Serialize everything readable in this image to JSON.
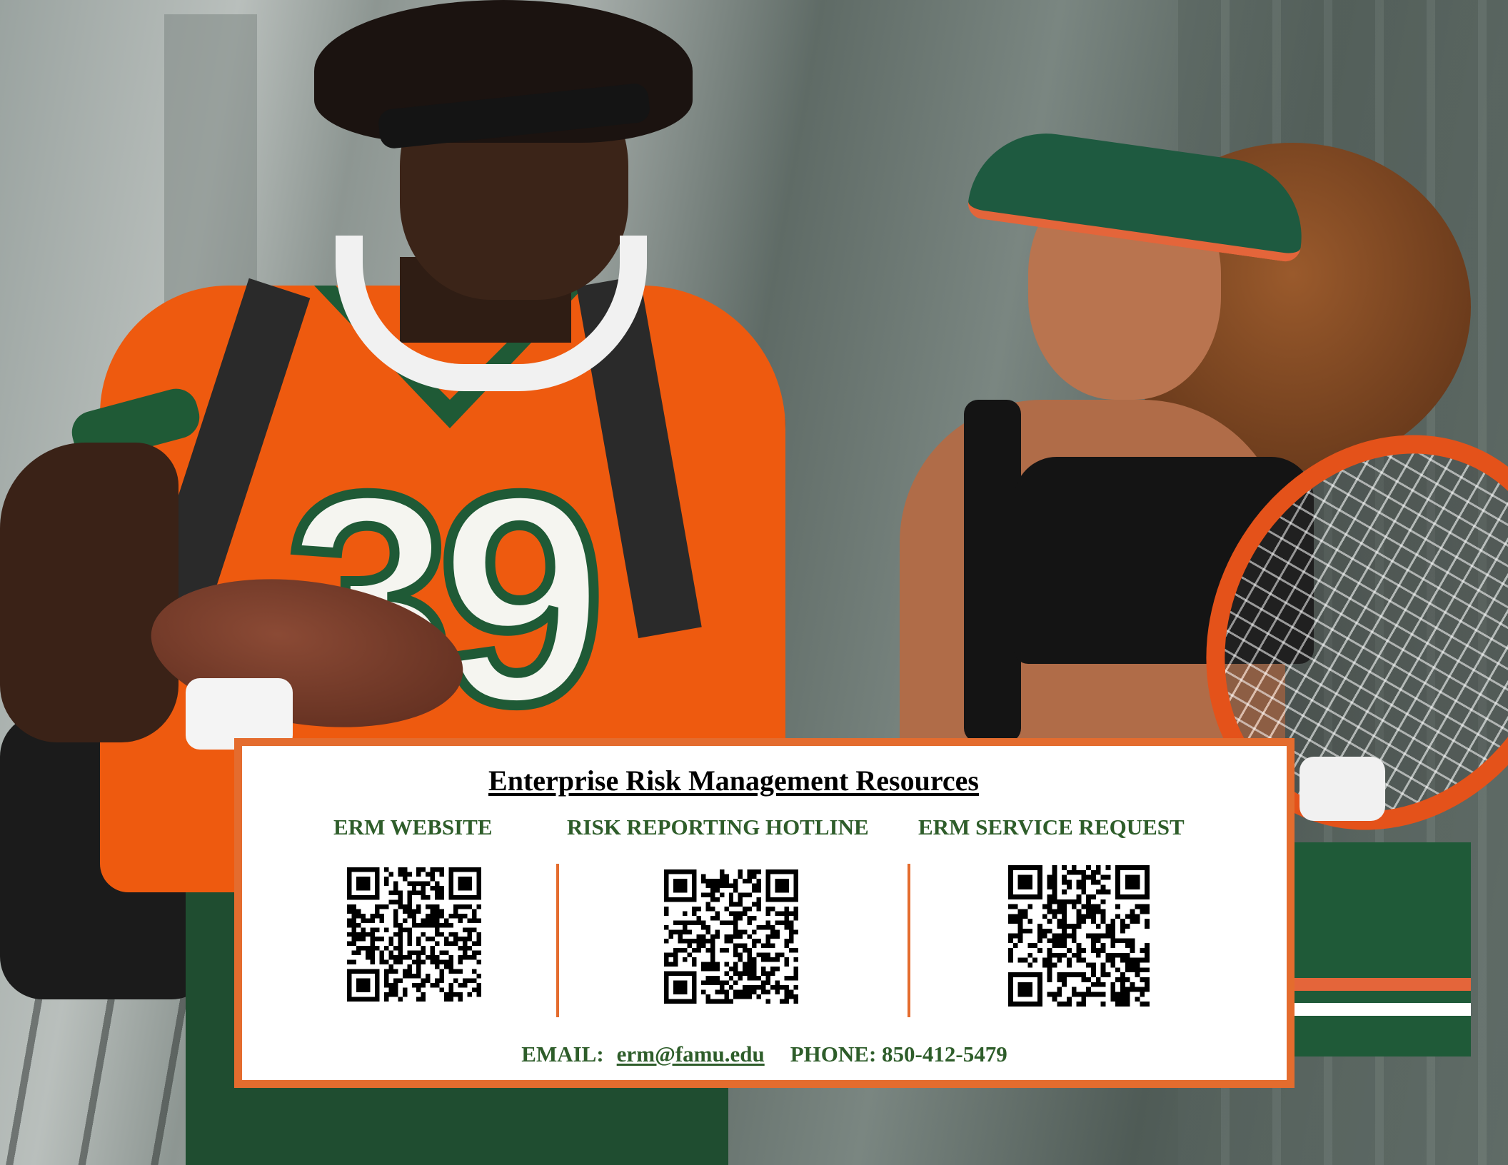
{
  "photo": {
    "jersey_number": "39"
  },
  "card": {
    "title": "Enterprise Risk Management Resources",
    "columns": [
      {
        "heading": "ERM WEBSITE"
      },
      {
        "heading": "RISK REPORTING HOTLINE"
      },
      {
        "heading": "ERM SERVICE REQUEST"
      }
    ],
    "contact": {
      "email_label": "EMAIL:",
      "email": "erm@famu.edu",
      "phone_label": "PHONE:",
      "phone": "850-412-5479"
    }
  },
  "colors": {
    "accent_orange": "#e46c2e",
    "heading_green": "#2e5d2a"
  }
}
